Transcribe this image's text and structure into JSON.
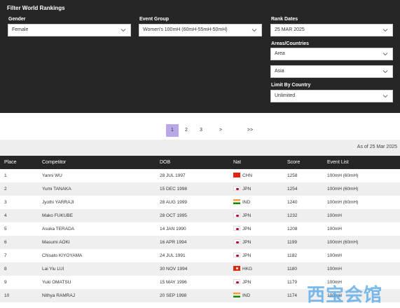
{
  "filter": {
    "title": "Filter World Rankings",
    "gender": {
      "label": "Gender",
      "value": "Female"
    },
    "event_group": {
      "label": "Event Group",
      "value": "Women's 100mH (60mH-55mH-50mH)"
    },
    "rank_dates": {
      "label": "Rank Dates",
      "value": "25 MAR 2025"
    },
    "areas": {
      "label": "Areas/Countries",
      "value1": "Area",
      "value2": "Asia"
    },
    "limit": {
      "label": "Limit By Country",
      "value": "Unlimited"
    }
  },
  "pagination": {
    "pages": [
      "1",
      "2",
      "3"
    ],
    "next": ">",
    "last": ">>",
    "active": "1"
  },
  "as_of": "As of 25 Mar 2025",
  "table": {
    "headers": {
      "place": "Place",
      "competitor": "Competitor",
      "dob": "DOB",
      "nat": "Nat",
      "score": "Score",
      "event_list": "Event List"
    },
    "rows": [
      {
        "place": "1",
        "competitor": "Yanni WU",
        "dob": "28 JUL 1997",
        "flag": "chn",
        "nat": "CHN",
        "score": "1258",
        "event": "100mH (60mH)"
      },
      {
        "place": "2",
        "competitor": "Yumi TANAKA",
        "dob": "15 DEC 1998",
        "flag": "jpn",
        "nat": "JPN",
        "score": "1254",
        "event": "100mH (60mH)"
      },
      {
        "place": "3",
        "competitor": "Jyothi YARRAJI",
        "dob": "28 AUG 1999",
        "flag": "ind",
        "nat": "IND",
        "score": "1240",
        "event": "100mH (60mH)"
      },
      {
        "place": "4",
        "competitor": "Mako FUKUBE",
        "dob": "28 OCT 1995",
        "flag": "jpn",
        "nat": "JPN",
        "score": "1232",
        "event": "100mH"
      },
      {
        "place": "5",
        "competitor": "Asuka TERADA",
        "dob": "14 JAN 1990",
        "flag": "jpn",
        "nat": "JPN",
        "score": "1208",
        "event": "100mH"
      },
      {
        "place": "6",
        "competitor": "Masumi AOKI",
        "dob": "16 APR 1994",
        "flag": "jpn",
        "nat": "JPN",
        "score": "1199",
        "event": "100mH (60mH)"
      },
      {
        "place": "7",
        "competitor": "Chisato KIYOYAMA",
        "dob": "24 JUL 1991",
        "flag": "jpn",
        "nat": "JPN",
        "score": "1182",
        "event": "100mH"
      },
      {
        "place": "8",
        "competitor": "Lai Yiu LUI",
        "dob": "30 NOV 1994",
        "flag": "hkg",
        "nat": "HKG",
        "score": "1180",
        "event": "100mH"
      },
      {
        "place": "9",
        "competitor": "Yuki OMATSU",
        "dob": "15 MAY 1996",
        "flag": "jpn",
        "nat": "JPN",
        "score": "1179",
        "event": "100mH"
      },
      {
        "place": "10",
        "competitor": "Nithya RAMRAJ",
        "dob": "20 SEP 1998",
        "flag": "ind",
        "nat": "IND",
        "score": "1174",
        "event": "100mH"
      }
    ]
  },
  "watermark": "西宝会馆",
  "colors": {
    "panel": "#262626",
    "active_page": "#b9a7e8",
    "watermark": "#4fa4e8"
  },
  "icons": {
    "dropdown": "chevron-down-icon"
  }
}
